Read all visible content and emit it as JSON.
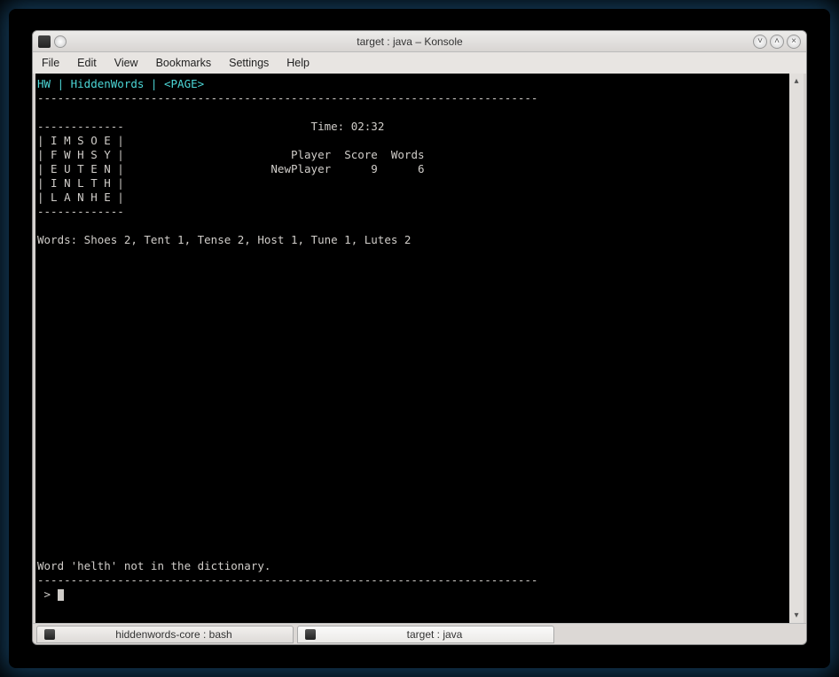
{
  "window": {
    "title": "target : java – Konsole"
  },
  "menu": {
    "file": "File",
    "edit": "Edit",
    "view": "View",
    "bookmarks": "Bookmarks",
    "settings": "Settings",
    "help": "Help"
  },
  "term": {
    "header": "HW | HiddenWords | <PAGE>",
    "dash_long": "---------------------------------------------------------------------------",
    "board_top": "-------------",
    "board_r1": "| I M S O E |",
    "board_r2": "| F W H S Y |",
    "board_r3": "| E U T E N |",
    "board_r4": "| I N L T H |",
    "board_r5": "| L A N H E |",
    "board_bot": "-------------",
    "time_line": "                            Time: 02:32",
    "score_head": "                         Player  Score  Words",
    "score_row": "                      NewPlayer      9      6",
    "words_line": "Words: Shoes 2, Tent 1, Tense 2, Host 1, Tune 1, Lutes 2",
    "error_line": "Word 'helth' not in the dictionary.",
    "prompt": " > "
  },
  "tabs": {
    "t1": "hiddenwords-core : bash",
    "t2": "target : java"
  }
}
